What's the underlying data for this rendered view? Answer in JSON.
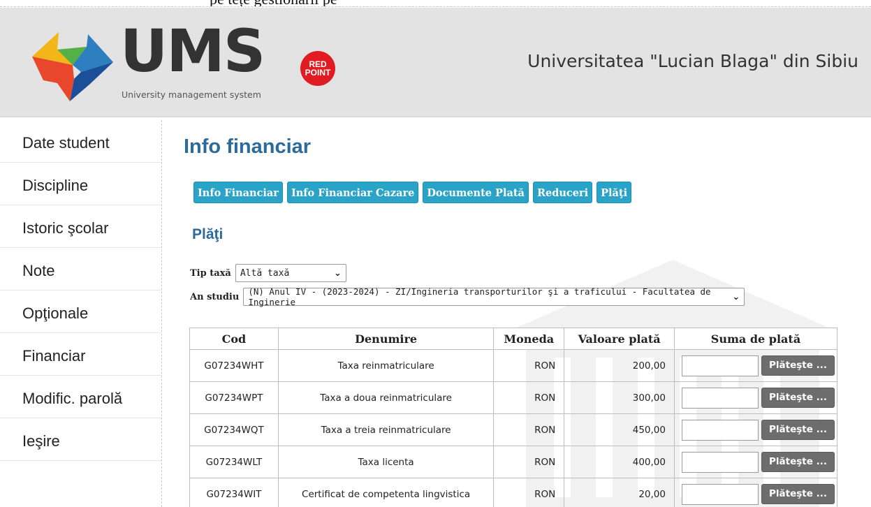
{
  "top_strip": {
    "text": "pe tețe gestionării pe"
  },
  "header": {
    "logo_text": "UMS",
    "logo_subtitle": "University management system",
    "badge_text_1": "RED",
    "badge_text_2": "POINT",
    "university": "Universitatea \"Lucian Blaga\" din Sibiu"
  },
  "sidebar": {
    "items": [
      {
        "label": "Date student",
        "icon": "none"
      },
      {
        "label": "Discipline"
      },
      {
        "label": "Istoric şcolar"
      },
      {
        "label": "Note"
      },
      {
        "label": "Opţionale"
      },
      {
        "label": "Financiar"
      },
      {
        "label": "Modific. parolă"
      },
      {
        "label": "Ieşire"
      }
    ]
  },
  "main": {
    "title": "Info financiar",
    "tabs": [
      {
        "label": "Info Financiar"
      },
      {
        "label": "Info Financiar Cazare"
      },
      {
        "label": "Documente Plată"
      },
      {
        "label": "Reduceri"
      },
      {
        "label": "Plăţi"
      }
    ],
    "section_title": "Plăţi",
    "filters": {
      "tip_taxa_label": "Tip taxă",
      "tip_taxa_value": "Altă taxă",
      "an_studiu_label": "An studiu",
      "an_studiu_value": "(N) Anul IV - (2023-2024) - ZI/Ingineria transporturilor şi a traficului - Facultatea de Inginerie"
    },
    "table": {
      "headers": [
        "Cod",
        "Denumire",
        "Moneda",
        "Valoare plată",
        "Suma de plată"
      ],
      "pay_button_label": "Plăteşte ...",
      "rows": [
        {
          "cod": "G07234WHT",
          "denumire": "Taxa reinmatriculare",
          "moneda": "RON",
          "valoare": "200,00"
        },
        {
          "cod": "G07234WPT",
          "denumire": "Taxa a doua reinmatriculare",
          "moneda": "RON",
          "valoare": "300,00"
        },
        {
          "cod": "G07234WQT",
          "denumire": "Taxa a treia reinmatriculare",
          "moneda": "RON",
          "valoare": "450,00"
        },
        {
          "cod": "G07234WLT",
          "denumire": "Taxa licenta",
          "moneda": "RON",
          "valoare": "400,00"
        },
        {
          "cod": "G07234WIT",
          "denumire": "Certificat de competenta lingvistica",
          "moneda": "RON",
          "valoare": "20,00"
        }
      ]
    }
  },
  "colors": {
    "accent": "#2aa3c9",
    "title_blue": "#2b6a9a",
    "header_bg": "#e3e3e3",
    "pay_button": "#6d6d6d",
    "badge_red": "#e11b22"
  }
}
